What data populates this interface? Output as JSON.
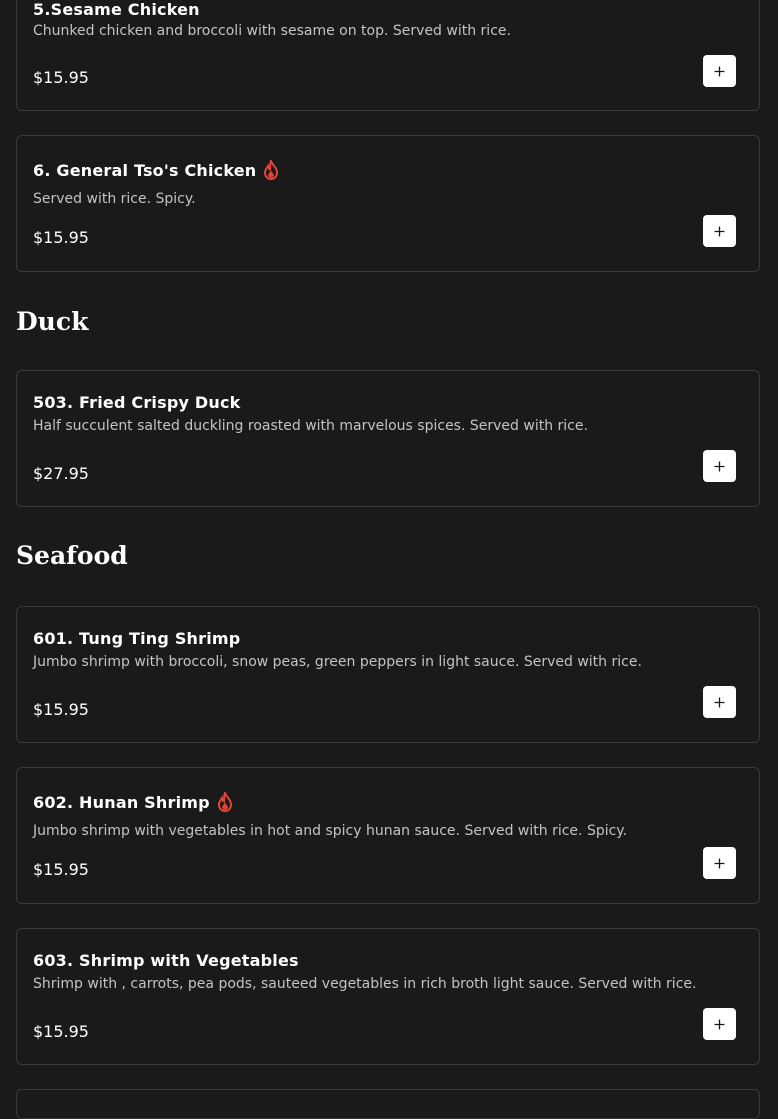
{
  "items_chicken": [
    {
      "title": "5.Sesame Chicken",
      "description": "Chunked chicken and broccoli with sesame on top. Served with rice.",
      "price": "$15.95",
      "spicy": false
    },
    {
      "title": "6. General Tso's Chicken",
      "description": "Served with rice. Spicy.",
      "price": "$15.95",
      "spicy": true
    }
  ],
  "sections": {
    "duck": "Duck",
    "seafood": "Seafood"
  },
  "items_duck": [
    {
      "title": "503. Fried Crispy Duck",
      "description": "Half succulent salted duckling roasted with marvelous spices. Served with rice.",
      "price": "$27.95",
      "spicy": false
    }
  ],
  "items_seafood": [
    {
      "title": "601. Tung Ting Shrimp",
      "description": "Jumbo shrimp with broccoli, snow peas, green peppers in light sauce. Served with rice.",
      "price": "$15.95",
      "spicy": false
    },
    {
      "title": "602. Hunan Shrimp",
      "description": "Jumbo shrimp with vegetables in hot and spicy hunan sauce. Served with rice. Spicy.",
      "price": "$15.95",
      "spicy": true
    },
    {
      "title": "603. Shrimp with Vegetables",
      "description": "Shrimp with , carrots, pea pods, sauteed vegetables in rich broth light sauce. Served with rice.",
      "price": "$15.95",
      "spicy": false
    }
  ],
  "icons": {
    "add": "plus-icon",
    "spicy": "fire-icon"
  },
  "colors": {
    "background": "#1b1a1b",
    "card_border": "#3a393a",
    "spicy": "#e0463a",
    "button": "#ffffff"
  }
}
